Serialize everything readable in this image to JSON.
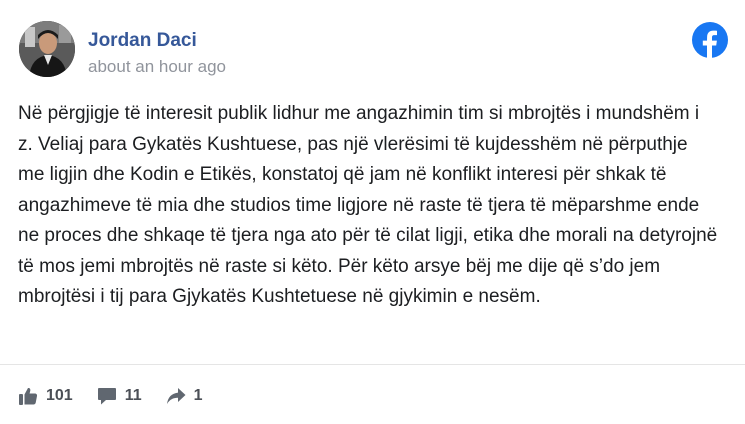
{
  "post": {
    "author": "Jordan Daci",
    "timestamp": "about an hour ago",
    "text": "Në përgjigje të interesit publik lidhur me angazhimin tim si mbrojtës i mundshëm i z. Veliaj para Gykatës Kushtuese, pas një vlerësimi të kujdesshëm në përputhje me ligjin dhe Kodin e Etikës, konstatoj që jam në konflikt interesi për shkak të angazhimeve të mia dhe studios time ligjore në raste të tjera të mëparshme ende ne proces dhe shkaqe të tjera nga ato për të cilat ligji, etika dhe morali na detyrojnë të mos jemi mbrojtës në raste si këto. Për këto arsye bëj me dije që s’do jem mbrojtësi i tij para Gjykatës Kushtetuese në gjykimin e nesëm."
  },
  "stats": {
    "likes": "101",
    "comments": "11",
    "shares": "1"
  },
  "icons": {
    "platform": "facebook-logo-icon",
    "like": "thumbs-up-icon",
    "comment": "comment-bubble-icon",
    "share": "share-arrow-icon"
  },
  "colors": {
    "author_name": "#365899",
    "facebook_blue": "#1877f2",
    "muted_text": "#90949c",
    "stat_icon": "#606770"
  }
}
